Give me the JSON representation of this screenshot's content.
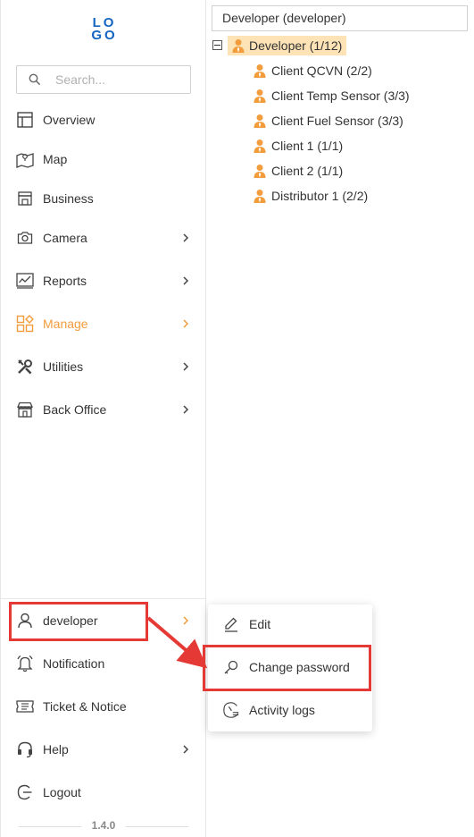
{
  "logo_text": "LOGO",
  "search": {
    "placeholder": "Search..."
  },
  "nav": [
    {
      "label": "Overview",
      "icon": "overview-icon",
      "has_submenu": false
    },
    {
      "label": "Map",
      "icon": "map-icon",
      "has_submenu": false
    },
    {
      "label": "Business",
      "icon": "business-icon",
      "has_submenu": false
    },
    {
      "label": "Camera",
      "icon": "camera-icon",
      "has_submenu": true
    },
    {
      "label": "Reports",
      "icon": "reports-icon",
      "has_submenu": true
    },
    {
      "label": "Manage",
      "icon": "manage-icon",
      "has_submenu": true,
      "active": true
    },
    {
      "label": "Utilities",
      "icon": "utilities-icon",
      "has_submenu": true
    },
    {
      "label": "Back Office",
      "icon": "back-office-icon",
      "has_submenu": true
    }
  ],
  "bottom_nav": [
    {
      "label": "developer",
      "icon": "user-icon",
      "has_submenu": true
    },
    {
      "label": "Notification",
      "icon": "bell-icon",
      "has_submenu": false
    },
    {
      "label": "Ticket & Notice",
      "icon": "ticket-icon",
      "has_submenu": false
    },
    {
      "label": "Help",
      "icon": "headset-icon",
      "has_submenu": true
    },
    {
      "label": "Logout",
      "icon": "logout-icon",
      "has_submenu": false
    }
  ],
  "version": "1.4.0",
  "tree": {
    "header": "Developer (developer)",
    "root": "Developer (1/12)",
    "children": [
      "Client QCVN (2/2)",
      "Client Temp Sensor (3/3)",
      "Client Fuel Sensor (3/3)",
      "Client 1 (1/1)",
      "Client 2 (1/1)",
      "Distributor 1 (2/2)"
    ]
  },
  "user_menu": [
    {
      "label": "Edit",
      "icon": "pencil-icon"
    },
    {
      "label": "Change password",
      "icon": "key-icon"
    },
    {
      "label": "Activity logs",
      "icon": "history-icon"
    }
  ],
  "colors": {
    "accent": "#f39c3c",
    "logo": "#1565c0",
    "highlight": "#e53935",
    "tree_selected_bg": "#fde3b6"
  }
}
